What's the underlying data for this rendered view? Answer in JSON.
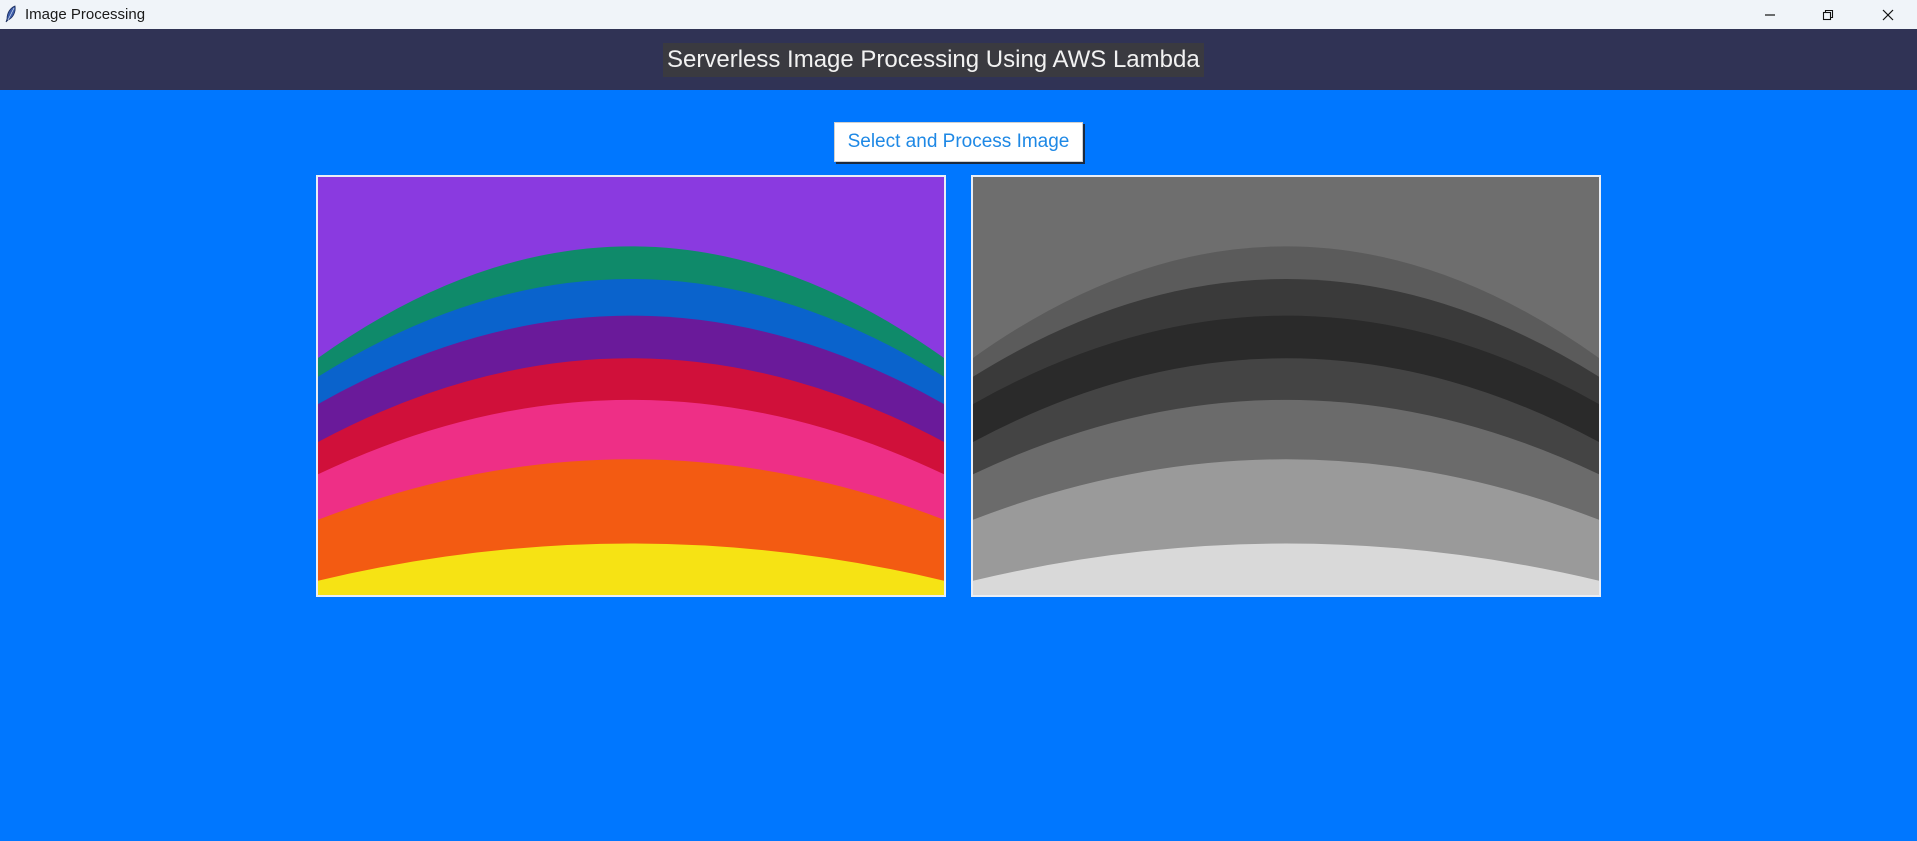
{
  "window": {
    "title": "Image Processing",
    "controls": [
      "minimize-icon",
      "restore-icon",
      "close-icon"
    ]
  },
  "header": {
    "title": "Serverless Image Processing Using AWS Lambda"
  },
  "toolbar": {
    "process_label": "Select and Process Image"
  },
  "images": {
    "original": {
      "bands": [
        "#0f8a6a",
        "#0a63cc",
        "#6a1a9a",
        "#d0103a",
        "#ee2f86",
        "#f35b12",
        "#f6e314"
      ],
      "background": "#8a3ae0"
    },
    "processed": {
      "bands": [
        "#5b5b5b",
        "#3a3a3a",
        "#2a2a2a",
        "#444444",
        "#6b6b6b",
        "#9a9a9a",
        "#d9d9d9"
      ],
      "background": "#6e6e6e"
    }
  },
  "colors": {
    "window_background": "#0077ff",
    "header_background": "#303355",
    "button_text": "#1e88e5"
  }
}
